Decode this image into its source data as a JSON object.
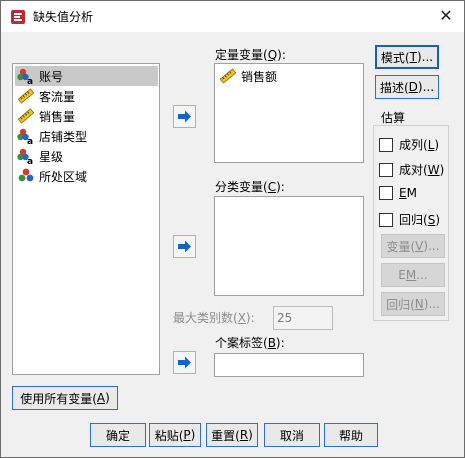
{
  "window": {
    "title": "缺失值分析",
    "close_glyph": "✕"
  },
  "variables": [
    {
      "name": "账号",
      "icon": "nominal-string-icon",
      "selected": true
    },
    {
      "name": "客流量",
      "icon": "scale-ruler-icon",
      "selected": false
    },
    {
      "name": "销售量",
      "icon": "scale-ruler-icon",
      "selected": false
    },
    {
      "name": "店铺类型",
      "icon": "nominal-string-icon",
      "selected": false
    },
    {
      "name": "星级",
      "icon": "nominal-string-icon",
      "selected": false
    },
    {
      "name": "所处区域",
      "icon": "nominal-icon",
      "selected": false
    }
  ],
  "quantitative": {
    "label": "定量变量(",
    "key": "Q",
    "suffix": "):",
    "items": [
      {
        "name": "销售额",
        "icon": "scale-ruler-icon"
      }
    ]
  },
  "categorical": {
    "label": "分类变量(",
    "key": "C",
    "suffix": "):"
  },
  "max_categories": {
    "label": "最大类别数(",
    "key": "X",
    "suffix": "):",
    "value": "25"
  },
  "case_labels": {
    "label": "个案标签(",
    "key": "B",
    "suffix": "):"
  },
  "side_buttons": {
    "patterns": {
      "pre": "模式(",
      "key": "T",
      "post": ")..."
    },
    "describe": {
      "pre": "描述(",
      "key": "D",
      "post": ")..."
    }
  },
  "estimation": {
    "title": "估算",
    "options": [
      {
        "pre": "成列(",
        "key": "L",
        "post": ")"
      },
      {
        "pre": "成对(",
        "key": "W",
        "post": ")"
      },
      {
        "pre": "",
        "key": "E",
        "post": "M"
      },
      {
        "pre": "回归(",
        "key": "S",
        "post": ")"
      }
    ],
    "buttons": [
      {
        "pre": "变量(",
        "key": "V",
        "post": ")..."
      },
      {
        "pre": "E",
        "key": "M",
        "post": "..."
      },
      {
        "pre": "回归(",
        "key": "N",
        "post": ")..."
      }
    ]
  },
  "use_all": {
    "pre": "使用所有变量(",
    "key": "A",
    "post": ")"
  },
  "bottom": {
    "ok": "确定",
    "paste": {
      "pre": "粘贴(",
      "key": "P",
      "post": ")"
    },
    "reset": {
      "pre": "重置(",
      "key": "R",
      "post": ")"
    },
    "cancel": "取消",
    "help": "帮助"
  },
  "colors": {
    "accent": "#1a5fb4",
    "arrow": "#1565c0"
  }
}
